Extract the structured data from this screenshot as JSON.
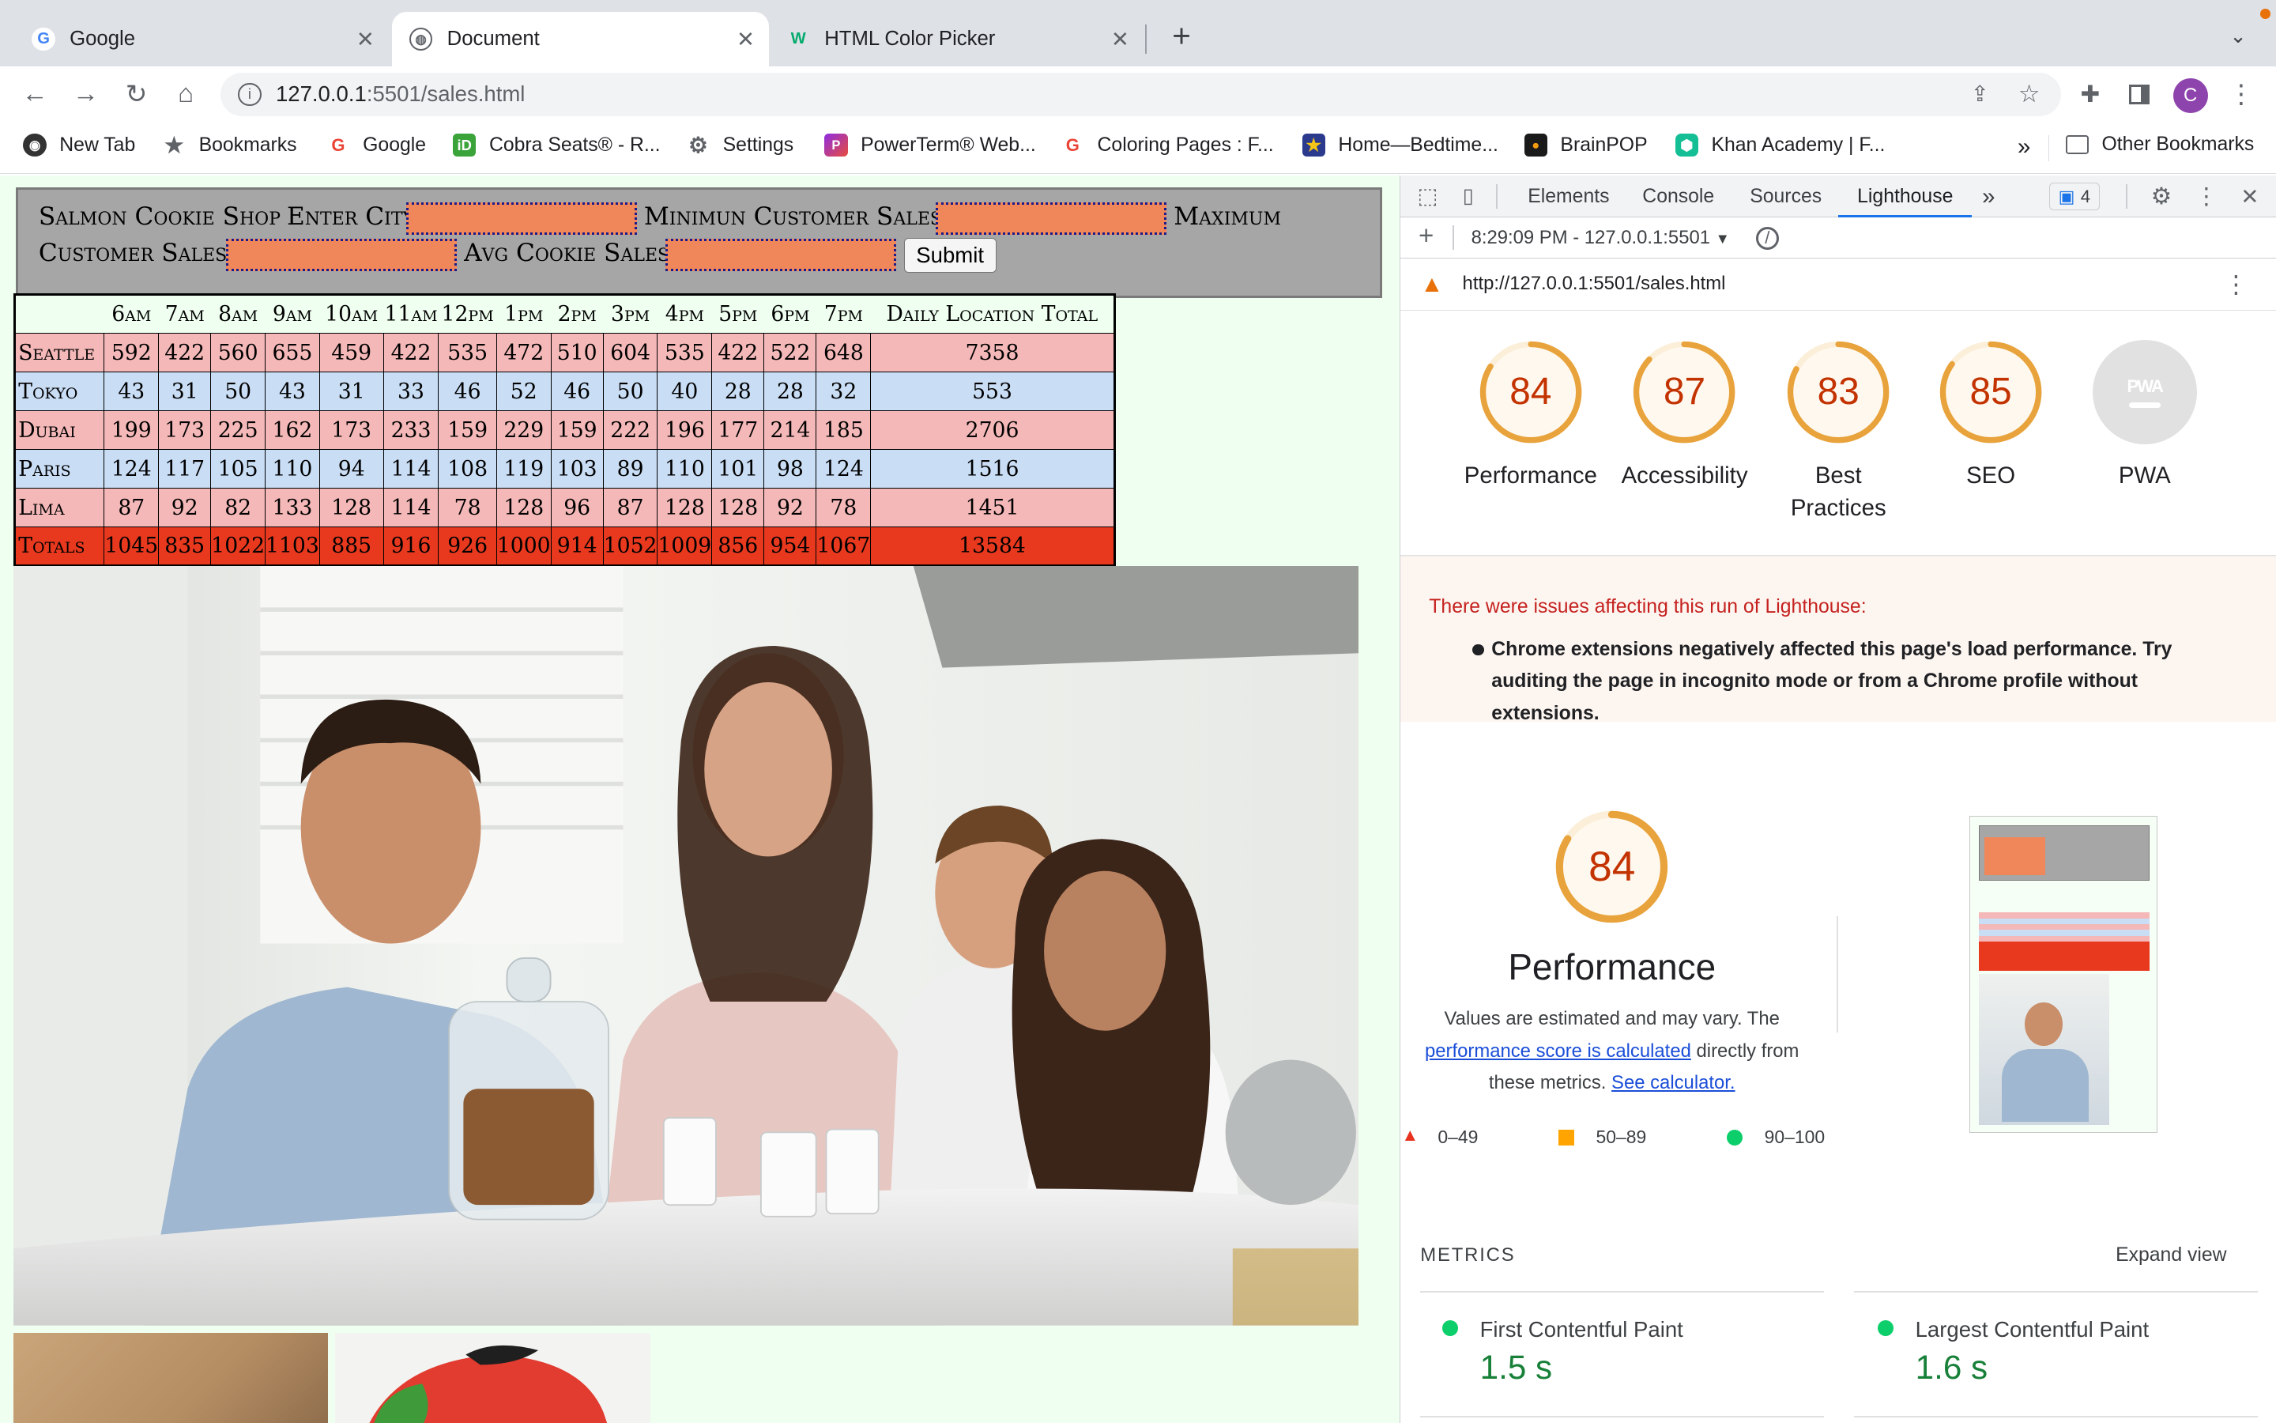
{
  "browser": {
    "tabs": [
      {
        "title": "Google",
        "favicon": "google-icon"
      },
      {
        "title": "Document",
        "favicon": "globe-icon"
      },
      {
        "title": "HTML Color Picker",
        "favicon": "w3-icon"
      }
    ],
    "address": {
      "host": "127.0.0.1",
      "path": ":5501/sales.html"
    },
    "profile_initial": "C",
    "bookmarks": [
      {
        "label": "New Tab",
        "icon": "newtab-icon"
      },
      {
        "label": "Bookmarks",
        "icon": "star-icon"
      },
      {
        "label": "Google",
        "icon": "google-icon"
      },
      {
        "label": "Cobra Seats® - R...",
        "icon": "cobra-icon"
      },
      {
        "label": "Settings",
        "icon": "gear-icon"
      },
      {
        "label": "PowerTerm® Web...",
        "icon": "powerterm-icon"
      },
      {
        "label": "Coloring Pages : F...",
        "icon": "google-icon"
      },
      {
        "label": "Home—Bedtime...",
        "icon": "star-badge-icon"
      },
      {
        "label": "BrainPOP",
        "icon": "brainpop-icon"
      },
      {
        "label": "Khan Academy | F...",
        "icon": "khan-icon"
      }
    ],
    "bookmarks_overflow": "»",
    "other_bookmarks": "Other Bookmarks"
  },
  "page": {
    "form": {
      "title": "Salmon Cookie Shop",
      "city_label": "Enter City",
      "min_label": "Minimun Customer Sales",
      "max_label_1": "Maximum",
      "max_label_2": "Customer Sales",
      "avg_label": "Avg Cookie Sales",
      "submit": "Submit"
    },
    "table": {
      "headers": [
        "",
        "6am",
        "7am",
        "8am",
        "9am",
        "10am",
        "11am",
        "12pm",
        "1pm",
        "2pm",
        "3pm",
        "4pm",
        "5pm",
        "6pm",
        "7pm",
        "Daily Location Total"
      ],
      "rows": [
        {
          "city": "Seattle",
          "values": [
            "592",
            "422",
            "560",
            "655",
            "459",
            "422",
            "535",
            "472",
            "510",
            "604",
            "535",
            "422",
            "522",
            "648"
          ],
          "total": "7358",
          "style": "pink"
        },
        {
          "city": "Tokyo",
          "values": [
            "43",
            "31",
            "50",
            "43",
            "31",
            "33",
            "46",
            "52",
            "46",
            "50",
            "40",
            "28",
            "28",
            "32"
          ],
          "total": "553",
          "style": "blue"
        },
        {
          "city": "Dubai",
          "values": [
            "199",
            "173",
            "225",
            "162",
            "173",
            "233",
            "159",
            "229",
            "159",
            "222",
            "196",
            "177",
            "214",
            "185"
          ],
          "total": "2706",
          "style": "pink"
        },
        {
          "city": "Paris",
          "values": [
            "124",
            "117",
            "105",
            "110",
            "94",
            "114",
            "108",
            "119",
            "103",
            "89",
            "110",
            "101",
            "98",
            "124"
          ],
          "total": "1516",
          "style": "blue"
        },
        {
          "city": "Lima",
          "values": [
            "87",
            "92",
            "82",
            "133",
            "128",
            "114",
            "78",
            "128",
            "96",
            "87",
            "128",
            "128",
            "92",
            "78"
          ],
          "total": "1451",
          "style": "pink"
        },
        {
          "city": "Totals",
          "values": [
            "1045",
            "835",
            "1022",
            "1103",
            "885",
            "916",
            "926",
            "1000",
            "914",
            "1052",
            "1009",
            "856",
            "954",
            "1067"
          ],
          "total": "13584",
          "style": "red"
        }
      ]
    }
  },
  "devtools": {
    "tabs": [
      "Elements",
      "Console",
      "Sources",
      "Lighthouse"
    ],
    "active_tab": "Lighthouse",
    "more": "»",
    "issues_count": "4",
    "report_time": "8:29:09 PM - 127.0.0.1:5501",
    "report_url": "http://127.0.0.1:5501/sales.html",
    "scores": [
      {
        "label": "Performance",
        "score": 84
      },
      {
        "label": "Accessibility",
        "score": 87
      },
      {
        "label": "Best Practices",
        "score": 83
      },
      {
        "label": "SEO",
        "score": 85
      }
    ],
    "pwa_label": "PWA",
    "pwa_badge": "PWA",
    "warning_title": "There were issues affecting this run of Lighthouse:",
    "warning_item": "Chrome extensions negatively affected this page's load performance. Try auditing the page in incognito mode or from a Chrome profile without extensions.",
    "perf_score": "84",
    "perf_title": "Performance",
    "perf_desc_1": "Values are estimated and may vary. The",
    "perf_link_1": "performance score is calculated",
    "perf_desc_2": "directly from",
    "perf_desc_3": "these metrics.",
    "perf_link_2": "See calculator.",
    "legend": [
      "0–49",
      "50–89",
      "90–100"
    ],
    "metrics_heading": "METRICS",
    "expand_view": "Expand view",
    "metrics": [
      {
        "name": "First Contentful Paint",
        "value": "1.5 s"
      },
      {
        "name": "Largest Contentful Paint",
        "value": "1.6 s"
      }
    ],
    "colors": {
      "orange": "#e8a33c",
      "red": "#c33300",
      "green": "#0cce6b",
      "link": "#1a4ed8"
    }
  }
}
